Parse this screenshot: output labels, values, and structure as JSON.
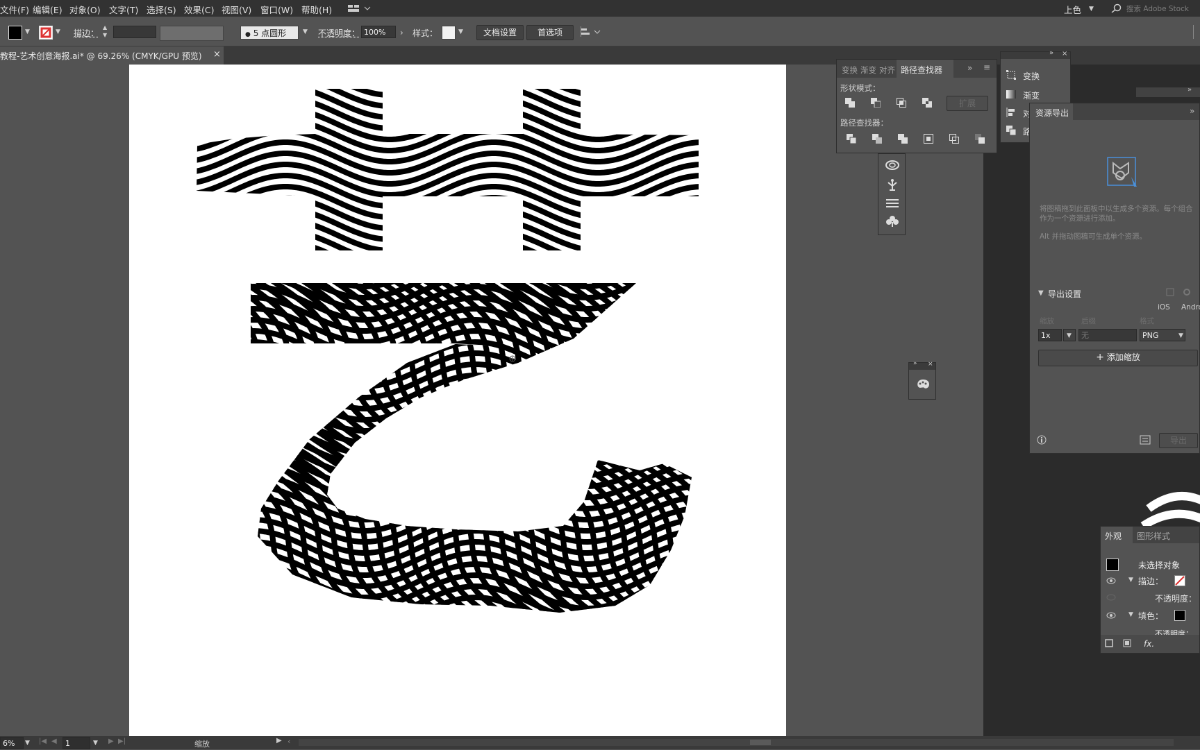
{
  "menubar": {
    "items": [
      "文件(F)",
      "编辑(E)",
      "对象(O)",
      "文字(T)",
      "选择(S)",
      "效果(C)",
      "视图(V)",
      "窗口(W)",
      "帮助(H)"
    ],
    "workspace": "上色",
    "search_placeholder": "搜索 Adobe Stock"
  },
  "control": {
    "stroke_label": "描边：",
    "brush": "5 点圆形",
    "opacity_label": "不透明度：",
    "opacity_value": "100%",
    "style_label": "样式：",
    "doc_setup": "文档设置",
    "prefs": "首选项"
  },
  "document": {
    "tab_title": "教程-艺术创意海报.ai* @ 69.26% (CMYK/GPU 预览)",
    "close": "×"
  },
  "pathfinder": {
    "tabs": [
      "变换",
      "渐变",
      "对齐",
      "路径查找器"
    ],
    "shape_modes_label": "形状模式：",
    "expand_label": "扩展",
    "pathfinders_label": "路径查找器："
  },
  "mini_panel": {
    "items": [
      "变换",
      "渐变",
      "对",
      "路"
    ]
  },
  "asset_export": {
    "title": "资源导出",
    "hint1": "将图稿拖到此面板中以生成多个资源。每个组合",
    "hint2": "作为一个资源进行添加。",
    "hint3": "Alt 并拖动图稿可生成单个资源。",
    "export_settings": "导出设置",
    "ios": "iOS",
    "android": "Andro",
    "col_scale": "缩放",
    "col_suffix": "后缀",
    "col_format": "格式",
    "scale": "1x",
    "suffix": "无",
    "format": "PNG",
    "add_scale": "添加缩放",
    "export_btn": "导出"
  },
  "appearance": {
    "tabs": [
      "外观",
      "图形样式"
    ],
    "no_selection": "未选择对象",
    "stroke": "描边：",
    "opacity1": "不透明度：",
    "fill": "填色：",
    "opacity2": "不透明度：",
    "fx": "fx."
  },
  "status": {
    "zoom": "69.26%",
    "zoom_display": "6%",
    "artboard": "1",
    "tool": "缩放"
  },
  "colors": {
    "menubar": "#323232",
    "panel": "#535353",
    "artboard": "#ffffff",
    "dark": "#2b2b2b",
    "accent": "#4a90d9"
  }
}
